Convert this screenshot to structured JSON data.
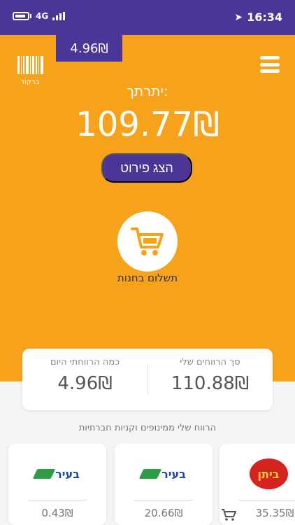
{
  "status_bar": {
    "network": "4G",
    "time": "16:34",
    "colors": {
      "bar": "#4b3596",
      "text": "#ffffff"
    }
  },
  "header": {
    "today_chip": "4.96₪",
    "barcode_label": "ברקוד"
  },
  "balance": {
    "label": "יתרתך:",
    "value": "109.77₪",
    "details_button": "הצג פירוט"
  },
  "payment": {
    "label": "תשלום בחנות"
  },
  "summary": {
    "total_label": "סך הרווחים שלי",
    "total_value": "110.88₪",
    "today_label": "כמה הרווחתי היום",
    "today_value": "4.96₪"
  },
  "brands": {
    "title": "הרווח שלי ממינופים וקניות חברתיות",
    "cards": [
      {
        "logo_text": "בעיר",
        "value": "0.43₪"
      },
      {
        "logo_text": "בעיר",
        "value": "20.66₪"
      },
      {
        "logo_text": "ביתן",
        "value": "35.35₪"
      }
    ]
  },
  "colors": {
    "primary": "#f7a21b",
    "accent": "#4b3596"
  }
}
